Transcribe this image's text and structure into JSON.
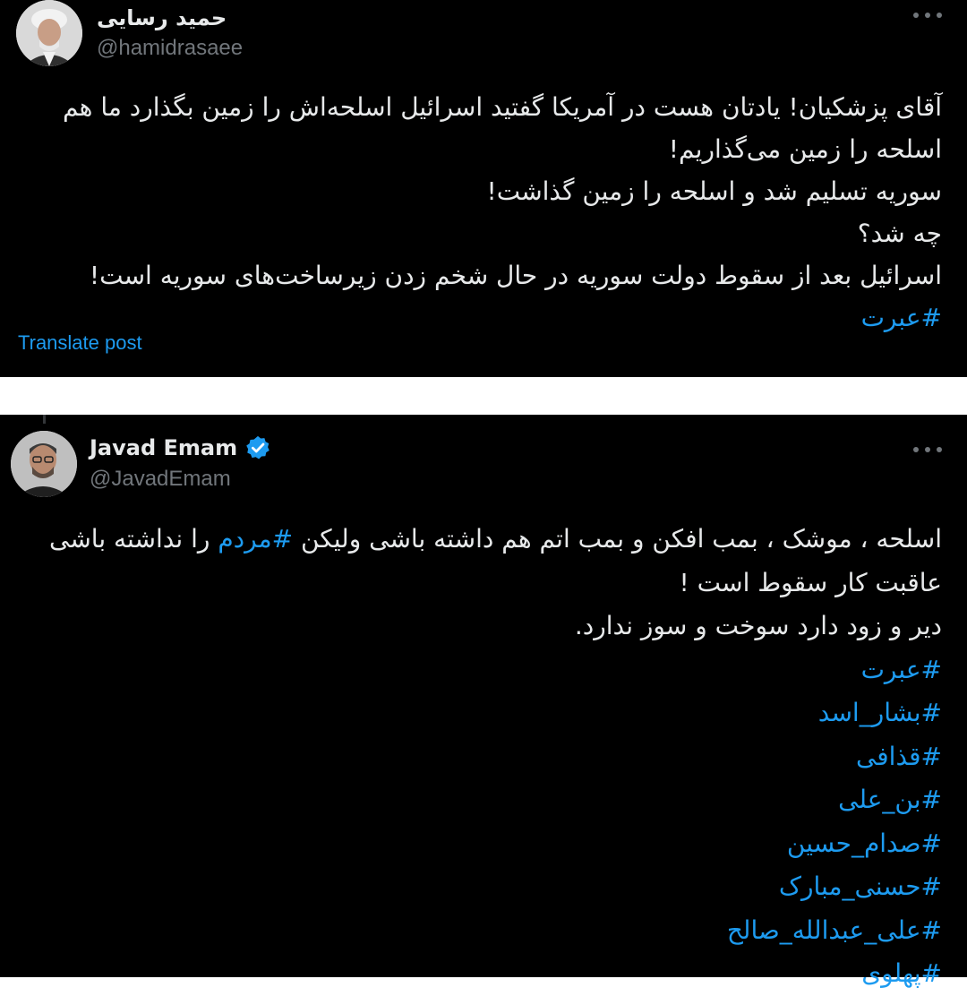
{
  "tweets": [
    {
      "author_name": "حمید رسایی",
      "handle": "@hamidrasaee",
      "lines": [
        "آقای پزشکیان! یادتان هست در آمریکا گفتید اسرائیل اسلحه‌اش را زمین بگذارد ما هم",
        "اسلحه را زمین می‌گذاریم!",
        "سوریه تسلیم شد و اسلحه را زمین گذاشت!",
        "چه شد؟",
        "اسرائیل بعد از سقوط دولت سوریه در حال شخم زدن زیرساخت‌های سوریه است!"
      ],
      "hashtag": "#عبرت",
      "translate_label": "Translate post",
      "avatar_icon": "avatar-cleric"
    },
    {
      "author_name": "Javad Emam",
      "handle": "@JavadEmam",
      "verified": true,
      "line1_before": "اسلحه ، موشک ، بمب افکن و بمب اتم هم داشته باشی ولیکن ",
      "line1_tag": "#مردم",
      "line1_after": " را نداشته باشی",
      "line2": "عاقبت کار سقوط است !",
      "line3": "دیر و زود دارد سوخت و سوز ندارد.",
      "hashtags": [
        "#عبرت",
        "#بشار_اسد",
        "#قذافی",
        "#بن_علی",
        "#صدام_حسین",
        "#حسنی_مبارک",
        "#علی_عبدالله_صالح",
        "#پهلوی"
      ],
      "avatar_icon": "avatar-man-glasses"
    }
  ],
  "colors": {
    "background": "#000000",
    "text": "#e7e9ea",
    "secondary": "#71767b",
    "link": "#1d9bf0",
    "verified": "#1d9bf0",
    "separator": "#ffffff"
  },
  "icons": {
    "more": "more-horizontal-icon",
    "verified": "verified-badge-icon"
  }
}
